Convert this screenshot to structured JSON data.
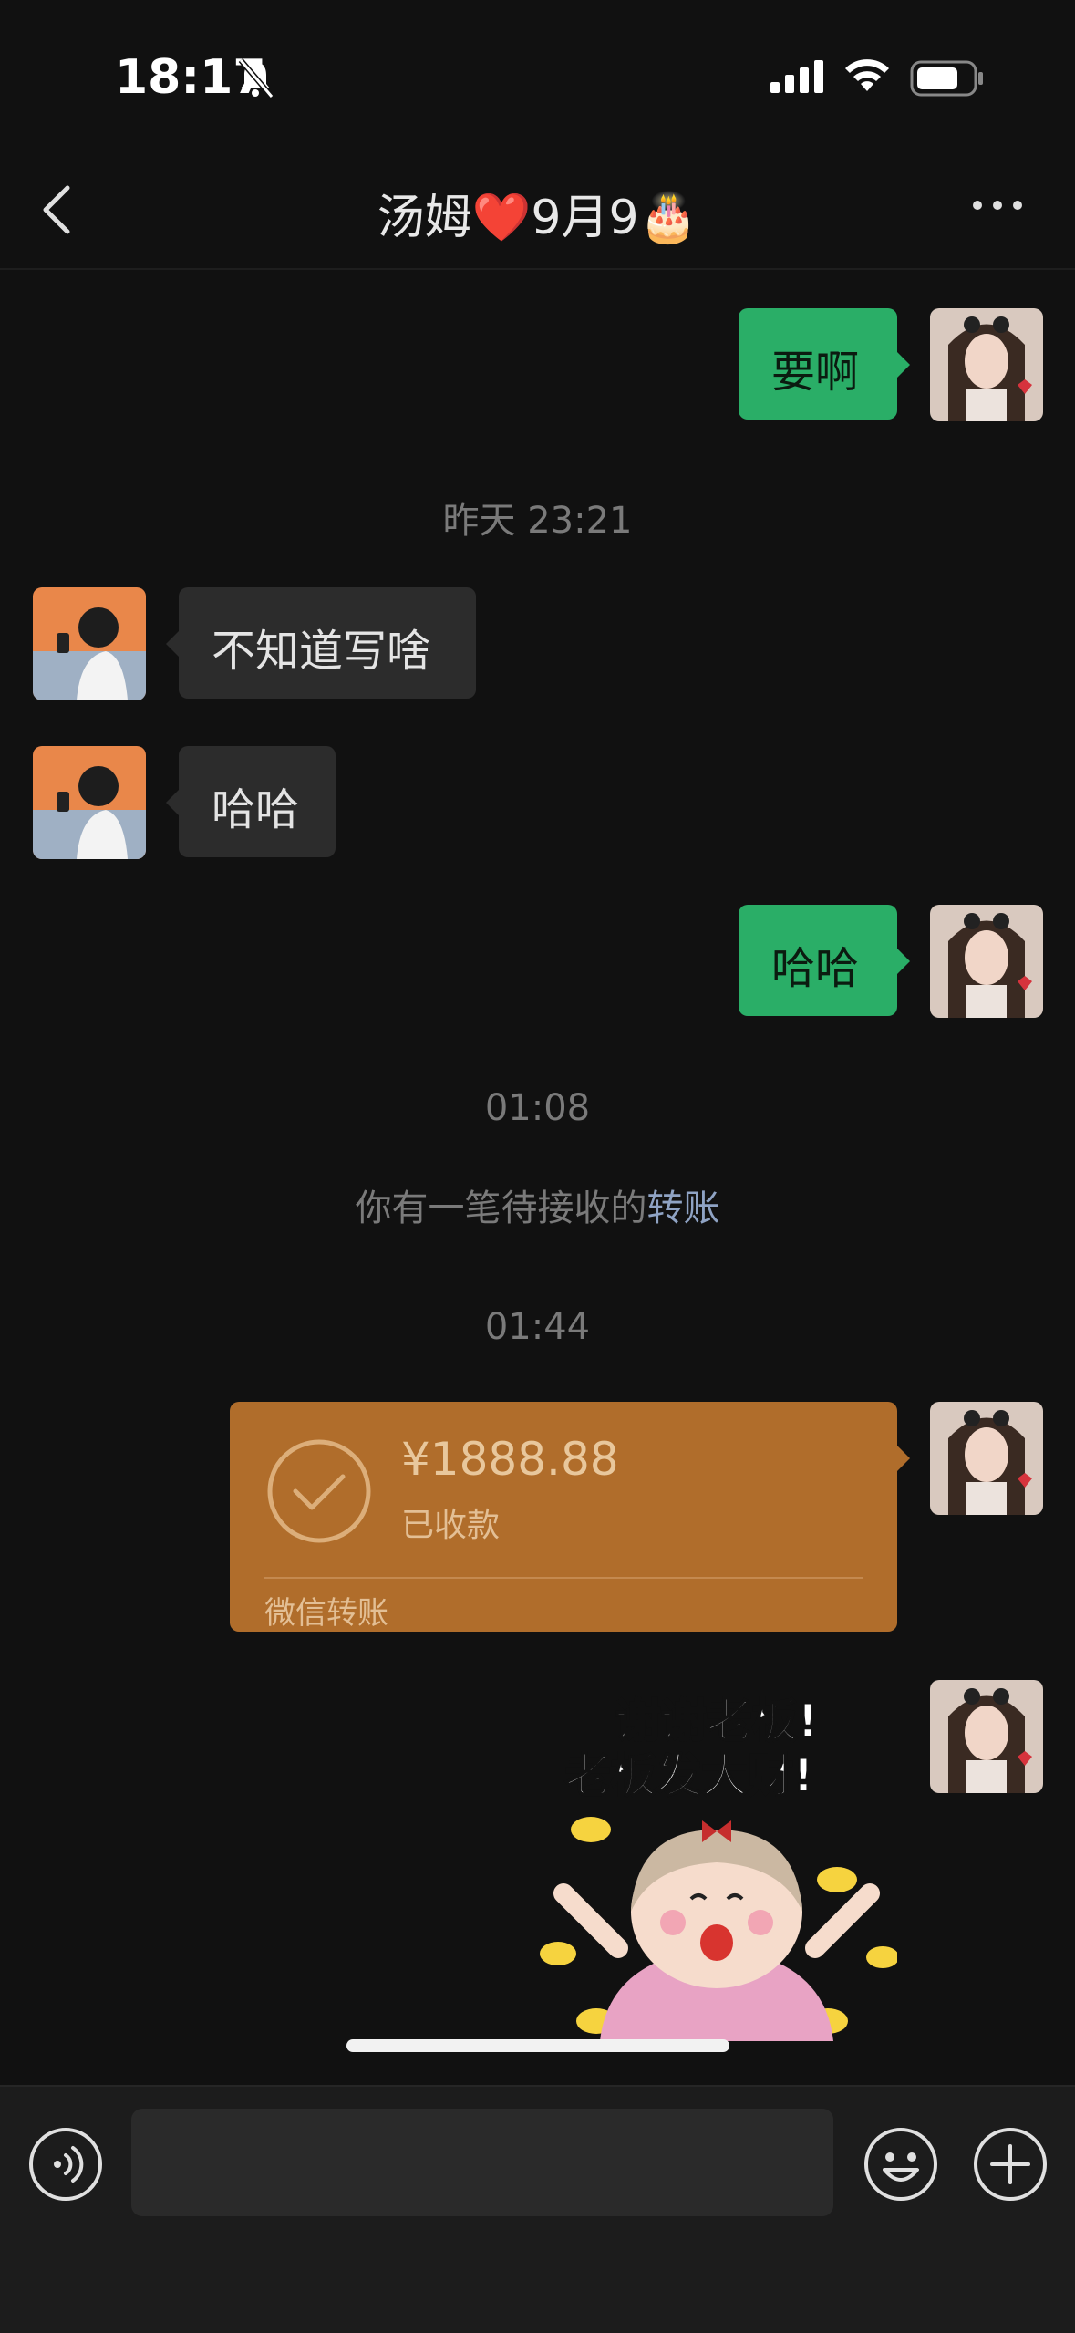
{
  "status_bar": {
    "time": "18:17"
  },
  "header": {
    "title": "汤姆❤️9月9🎂"
  },
  "messages": {
    "m1_text": "要啊",
    "ts1": "昨天 23:21",
    "m2_text": "不知道写啥",
    "m3_text": "哈哈",
    "m4_text": "哈哈",
    "ts2": "01:08",
    "system_prefix": "你有一笔待接收的",
    "system_link": "转账",
    "ts3": "01:44",
    "transfer_amount": "¥1888.88",
    "transfer_status": "已收款",
    "transfer_source": "微信转账",
    "sticker_line1": "谢谢老板!",
    "sticker_line2": "老板发大财!"
  },
  "colors": {
    "background": "#111111",
    "out_bubble": "#2aae67",
    "in_bubble": "#2c2c2c",
    "transfer_card": "#b06d2b",
    "link": "#8fa3c4"
  }
}
